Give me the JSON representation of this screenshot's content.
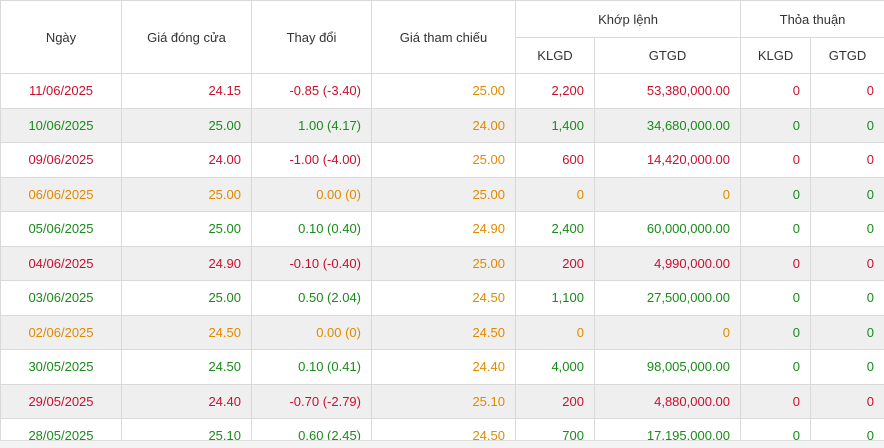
{
  "header": {
    "date": "Ngày",
    "close_price": "Giá đóng cửa",
    "change": "Thay đổi",
    "ref_price": "Giá tham chiếu",
    "matched_group": "Khớp lệnh",
    "matched_klgd": "KLGD",
    "matched_gtgd": "GTGD",
    "deal_group": "Thỏa thuận",
    "deal_klgd": "KLGD",
    "deal_gtgd": "GTGD"
  },
  "colors": {
    "down": "#c8102e",
    "up": "#1a8a1a",
    "reference": "#e08a00"
  },
  "rows": [
    {
      "date": "11/06/2025",
      "close": "24.15",
      "change": "-0.85 (-3.40)",
      "ref": "25.00",
      "m_klgd": "2,200",
      "m_gtgd": "53,380,000.00",
      "d_klgd": "0",
      "d_gtgd": "0",
      "status": "down"
    },
    {
      "date": "10/06/2025",
      "close": "25.00",
      "change": "1.00 (4.17)",
      "ref": "24.00",
      "m_klgd": "1,400",
      "m_gtgd": "34,680,000.00",
      "d_klgd": "0",
      "d_gtgd": "0",
      "status": "up"
    },
    {
      "date": "09/06/2025",
      "close": "24.00",
      "change": "-1.00 (-4.00)",
      "ref": "25.00",
      "m_klgd": "600",
      "m_gtgd": "14,420,000.00",
      "d_klgd": "0",
      "d_gtgd": "0",
      "status": "down"
    },
    {
      "date": "06/06/2025",
      "close": "25.00",
      "change": "0.00 (0)",
      "ref": "25.00",
      "m_klgd": "0",
      "m_gtgd": "0",
      "d_klgd": "0",
      "d_gtgd": "0",
      "status": "ref"
    },
    {
      "date": "05/06/2025",
      "close": "25.00",
      "change": "0.10 (0.40)",
      "ref": "24.90",
      "m_klgd": "2,400",
      "m_gtgd": "60,000,000.00",
      "d_klgd": "0",
      "d_gtgd": "0",
      "status": "up"
    },
    {
      "date": "04/06/2025",
      "close": "24.90",
      "change": "-0.10 (-0.40)",
      "ref": "25.00",
      "m_klgd": "200",
      "m_gtgd": "4,990,000.00",
      "d_klgd": "0",
      "d_gtgd": "0",
      "status": "down"
    },
    {
      "date": "03/06/2025",
      "close": "25.00",
      "change": "0.50 (2.04)",
      "ref": "24.50",
      "m_klgd": "1,100",
      "m_gtgd": "27,500,000.00",
      "d_klgd": "0",
      "d_gtgd": "0",
      "status": "up"
    },
    {
      "date": "02/06/2025",
      "close": "24.50",
      "change": "0.00 (0)",
      "ref": "24.50",
      "m_klgd": "0",
      "m_gtgd": "0",
      "d_klgd": "0",
      "d_gtgd": "0",
      "status": "ref"
    },
    {
      "date": "30/05/2025",
      "close": "24.50",
      "change": "0.10 (0.41)",
      "ref": "24.40",
      "m_klgd": "4,000",
      "m_gtgd": "98,005,000.00",
      "d_klgd": "0",
      "d_gtgd": "0",
      "status": "up"
    },
    {
      "date": "29/05/2025",
      "close": "24.40",
      "change": "-0.70 (-2.79)",
      "ref": "25.10",
      "m_klgd": "200",
      "m_gtgd": "4,880,000.00",
      "d_klgd": "0",
      "d_gtgd": "0",
      "status": "down"
    },
    {
      "date": "28/05/2025",
      "close": "25.10",
      "change": "0.60 (2.45)",
      "ref": "24.50",
      "m_klgd": "700",
      "m_gtgd": "17,195,000.00",
      "d_klgd": "0",
      "d_gtgd": "0",
      "status": "up"
    }
  ]
}
